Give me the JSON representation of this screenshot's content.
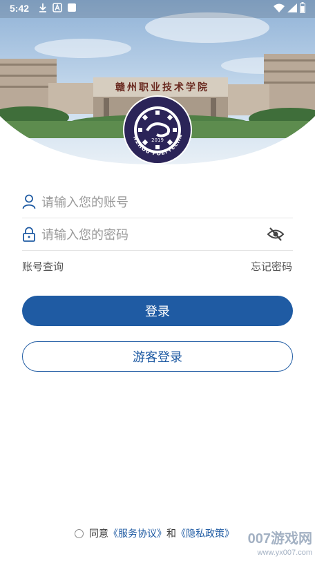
{
  "status_bar": {
    "time": "5:42"
  },
  "header": {
    "school_sign": "赣州职业技术学院",
    "logo_year": "2019",
    "logo_ring_text": "GANZHOU POLYTECHNIC"
  },
  "login": {
    "account_placeholder": "请输入您的账号",
    "password_placeholder": "请输入您的密码",
    "account_query_label": "账号查询",
    "forgot_password_label": "忘记密码",
    "login_button": "登录",
    "guest_login_button": "游客登录"
  },
  "agreement": {
    "prefix": "同意",
    "service_link": "《服务协议》",
    "and": "和",
    "privacy_link": "《隐私政策》"
  },
  "watermark": {
    "main": "007游戏网",
    "sub": "www.yx007.com"
  },
  "colors": {
    "primary": "#1f5ba3",
    "logo_navy": "#2b2458"
  }
}
